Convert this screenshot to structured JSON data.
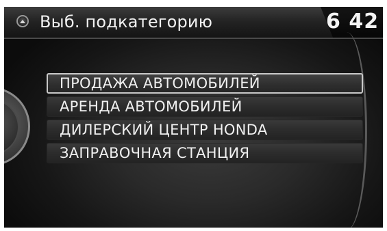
{
  "header": {
    "title": "Выб. подкатегорию",
    "clock": "6 42",
    "menu_icon": "navigation-menu-icon"
  },
  "list": {
    "selected_index": 0,
    "items": [
      {
        "label": "ПРОДАЖА АВТОМОБИЛЕЙ"
      },
      {
        "label": "АРЕНДА АВТОМОБИЛЕЙ"
      },
      {
        "label": "ДИЛЕРСКИЙ ЦЕНТР HONDA"
      },
      {
        "label": "ЗАПРАВОЧНАЯ СТАНЦИЯ"
      }
    ]
  },
  "colors": {
    "background": "#0b0b0b",
    "text": "#f0f0f0",
    "selection_border": "#c9c9c9"
  }
}
